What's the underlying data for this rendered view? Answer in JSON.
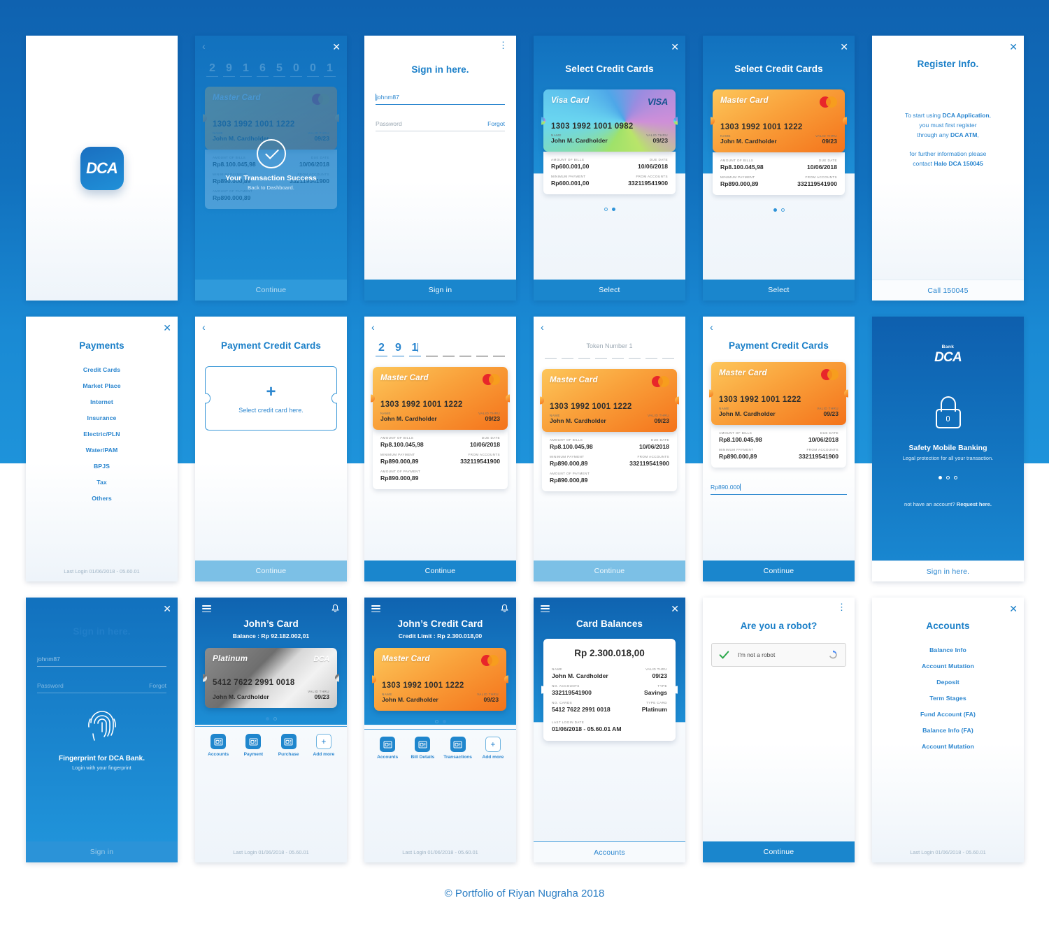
{
  "footer": "© Portfolio of Riyan Nugraha 2018",
  "brand": {
    "name": "DCA",
    "bank_word": "Bank"
  },
  "common": {
    "continue": "Continue",
    "select": "Select",
    "sign_in": "Sign in",
    "accounts": "Accounts",
    "last_login": "Last Login 01/06/2018 - 05.60.01",
    "close_icon": "✕",
    "back_icon": "‹",
    "dots_icon": "⋮"
  },
  "card_mc": {
    "brand": "Master Card",
    "number": "1303 1992 1001 1222",
    "name_label": "NAME",
    "name": "John M. Cardholder",
    "valid_label": "VALID THRU",
    "valid": "09/23"
  },
  "card_visa": {
    "brand": "Visa Card",
    "logo": "VISA",
    "number": "1303 1992 1001 0982",
    "name_label": "NAME",
    "name": "John M. Cardholder",
    "valid_label": "VALID THRU",
    "valid": "09/23"
  },
  "card_platinum": {
    "brand": "Platinum",
    "logo": "DCA",
    "number": "5412 7622 2991 0018",
    "name_label": "NAME",
    "name": "John M. Cardholder",
    "valid_label": "VALID THRU",
    "valid": "09/23"
  },
  "bills_mc": {
    "amount_label": "AMOUNT OF BILLS",
    "amount": "Rp8.100.045,98",
    "due_label": "DUE DATE",
    "due": "10/06/2018",
    "minimum_label": "MINIMUM PAYMENT",
    "minimum": "Rp890.000,89",
    "from_label": "FROM ACCOUNTS",
    "from": "332119541900",
    "payment_label": "AMOUNT OF PAYMENT",
    "payment": "Rp890.000,89"
  },
  "bills_visa": {
    "amount_label": "AMOUNT OF BILLS",
    "amount": "Rp600.001,00",
    "due_label": "DUE DATE",
    "due": "10/06/2018",
    "minimum_label": "MINIMUM PAYMENT",
    "minimum": "Rp600.001,00",
    "from_label": "FROM ACCOUNTS",
    "from": "332119541900"
  },
  "screens": {
    "splash": {
      "logo_text": "DCA"
    },
    "transaction_success": {
      "pin_digits": [
        "2",
        "9",
        "1",
        "6",
        "5",
        "0",
        "0",
        "1"
      ],
      "title": "Your Transaction Success",
      "subtitle": "Back to Dashboard.",
      "button": "Continue"
    },
    "signin": {
      "title": "Sign in here.",
      "username_value": "johnm87",
      "password_placeholder": "Password",
      "forgot": "Forgot",
      "button": "Sign in"
    },
    "select_visa": {
      "title": "Select Credit Cards",
      "button": "Select",
      "active_dot": 2
    },
    "select_mc": {
      "title": "Select Credit Cards",
      "button": "Select",
      "active_dot": 1
    },
    "register_info": {
      "title": "Register Info.",
      "line1_a": "To start using ",
      "line1_b": "DCA Application",
      "line1_c": ",",
      "line2": "you must first register",
      "line3_a": "through any ",
      "line3_b": "DCA ATM",
      "line3_c": ",",
      "line4": "for further information please",
      "line5_a": "contact ",
      "line5_b": "Halo DCA 150045",
      "button": "Call 150045"
    },
    "payments": {
      "title": "Payments",
      "items": [
        "Credit Cards",
        "Market Place",
        "Internet",
        "Insurance",
        "Electric/PLN",
        "Water/PAM",
        "BPJS",
        "Tax",
        "Others"
      ],
      "last_login": "Last Login 01/06/2018 - 05.60.01"
    },
    "payment_cc_empty": {
      "title": "Payment Credit Cards",
      "placeholder": "Select credit card here.",
      "plus": "+",
      "button": "Continue"
    },
    "pin_entry": {
      "digits": [
        "2",
        "9",
        "1",
        "",
        "",
        "",
        "",
        ""
      ],
      "button": "Continue"
    },
    "token_entry": {
      "label": "Token Number 1",
      "digits": [
        "",
        "",
        "",
        "",
        "",
        "",
        "",
        ""
      ],
      "button": "Continue"
    },
    "payment_cc_amount": {
      "title": "Payment Credit Cards",
      "amount_value": "Rp890.000",
      "button": "Continue"
    },
    "safety": {
      "bank_word": "Bank",
      "logo": "DCA",
      "title": "Safety Mobile Banking",
      "subtitle": "Legal protection for all your transaction.",
      "active_dot": 1,
      "cta_pre": "not have an account? ",
      "cta_link": "Request here.",
      "button": "Sign in here."
    },
    "fingerprint": {
      "title_faded": "Sign in here.",
      "username_value": "johnm87",
      "password_placeholder": "Password",
      "forgot": "Forgot",
      "heading": "Fingerprint for DCA Bank.",
      "subheading": "Login with your fingerprint",
      "button": "Sign in"
    },
    "johns_card": {
      "title": "John’s Card",
      "subtitle": "Balance : Rp 92.182.002,01",
      "active_dot": 1,
      "actions": [
        "Accounts",
        "Payment",
        "Purchase",
        "Add more"
      ],
      "last_login": "Last Login 01/06/2018 - 05.60.01"
    },
    "johns_credit_card": {
      "title": "John’s Credit Card",
      "subtitle": "Credit Limit : Rp 2.300.018,00",
      "active_dot": 2,
      "actions": [
        "Accounts",
        "Bill Details",
        "Transactions",
        "Add more"
      ],
      "last_login": "Last Login 01/06/2018 - 05.60.01"
    },
    "card_balances": {
      "title": "Card Balances",
      "amount": "Rp 2.300.018,00",
      "rows": [
        {
          "l_label": "NAME",
          "l_value": "John M. Cardholder",
          "r_label": "VALID THRU",
          "r_value": "09/23"
        },
        {
          "l_label": "NO. ACCOUNTS",
          "l_value": "332119541900",
          "r_label": "TYPE",
          "r_value": "Savings"
        },
        {
          "l_label": "NO. CARDS",
          "l_value": "5412 7622 2991 0018",
          "r_label": "TYPE CARD",
          "r_value": "Platinum"
        }
      ],
      "last_login_label": "LAST LOGIN DATE",
      "last_login_value": "01/06/2018 - 05.60.01 AM",
      "button": "Accounts"
    },
    "robot": {
      "title": "Are you a robot?",
      "checkbox_label": "I'm not a robot",
      "button": "Continue"
    },
    "accounts": {
      "title": "Accounts",
      "items": [
        "Balance Info",
        "Account Mutation",
        "Deposit",
        "Term Stages",
        "Fund Account (FA)",
        "Balance Info (FA)",
        "Account Mutation"
      ],
      "last_login": "Last Login 01/06/2018 - 05.60.01"
    }
  },
  "colors": {
    "brand_blue": "#1065b5",
    "accent_blue": "#2b86cf",
    "button_blue": "#1a86cd",
    "mastercard_red": "#e8262a",
    "mastercard_orange": "#f79e1b",
    "check_green": "#2aa84a"
  }
}
